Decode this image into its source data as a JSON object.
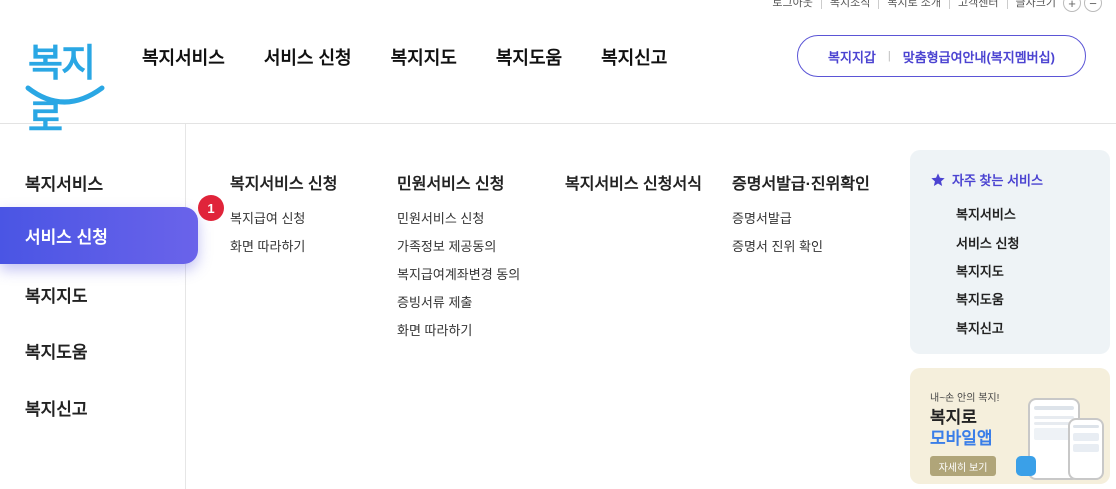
{
  "utility": {
    "links": [
      "로그아웃",
      "복지조직",
      "복지로 소개",
      "고객센터"
    ],
    "font_size_label": "글자크기",
    "zoom_in": "+",
    "zoom_out": "−"
  },
  "logo": {
    "text": "복지로"
  },
  "main_nav": [
    "복지서비스",
    "서비스 신청",
    "복지지도",
    "복지도움",
    "복지신고"
  ],
  "pill": {
    "left": "복지지갑",
    "separator": "|",
    "right": "맞춤형급여안내(복지멤버십)"
  },
  "side_menu": {
    "items": [
      "복지서비스",
      "서비스 신청",
      "복지지도",
      "복지도움",
      "복지신고"
    ],
    "active_index": 1
  },
  "badge": {
    "value": "1"
  },
  "columns": [
    {
      "title": "복지서비스 신청",
      "links": [
        "복지급여 신청",
        "화면 따라하기"
      ]
    },
    {
      "title": "민원서비스 신청",
      "links": [
        "민원서비스 신청",
        "가족정보 제공동의",
        "복지급여계좌변경 동의",
        "증빙서류 제출",
        "화면 따라하기"
      ]
    },
    {
      "title": "복지서비스 신청서식",
      "links": []
    },
    {
      "title": "증명서발급·진위확인",
      "links": [
        "증명서발급",
        "증명서 진위 확인"
      ]
    }
  ],
  "favorites": {
    "title": "자주 찾는 서비스",
    "items": [
      "복지서비스",
      "서비스 신청",
      "복지지도",
      "복지도움",
      "복지신고"
    ]
  },
  "app_banner": {
    "tagline": "내~손 안의 복지!",
    "name_line1": "복지로",
    "name_line2": "모바일앱",
    "button": "자세히 보기"
  },
  "colors": {
    "accent": "#4b43d1",
    "active_gradient_start": "#4a55e4",
    "badge": "#e0243a",
    "logo": "#2aa7e4",
    "favorites_bg": "#eef3f6",
    "app_bg": "#f5efdc"
  }
}
